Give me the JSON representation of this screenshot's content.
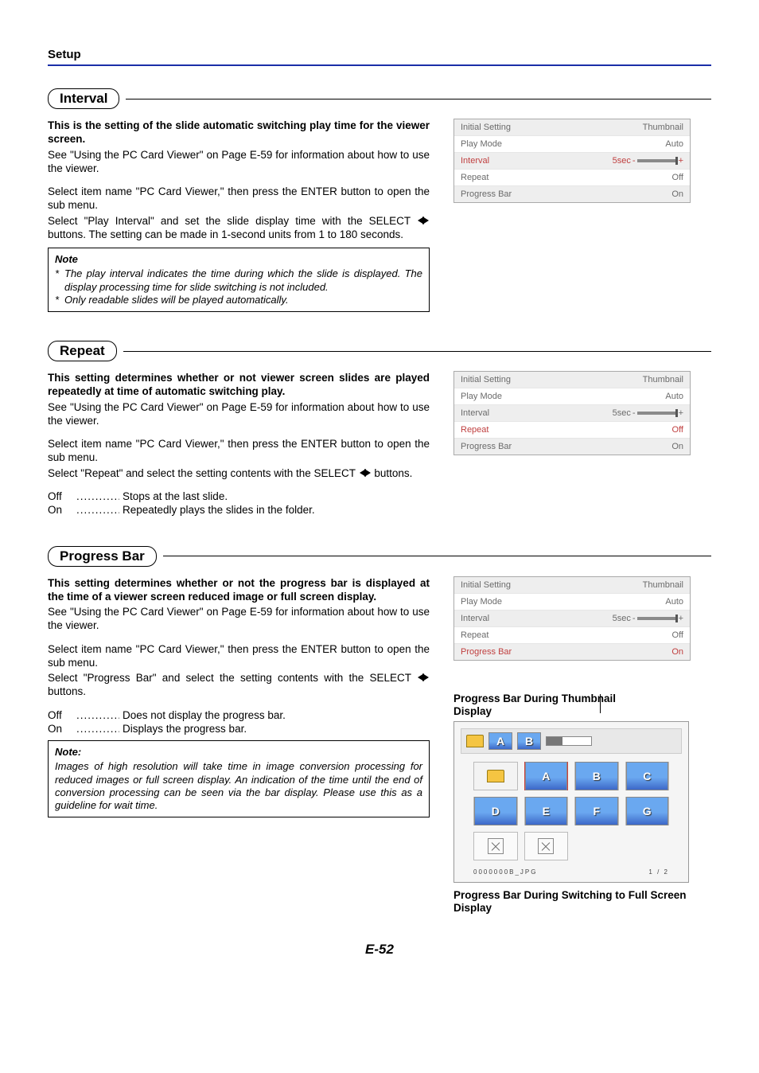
{
  "header": "Setup",
  "section_interval": {
    "title": "Interval",
    "lead": "This is the setting of the slide automatic switching play time for the viewer screen.",
    "p1": "See \"Using the PC Card Viewer\" on Page E-59 for information about how to use the viewer.",
    "p2": "Select item name \"PC Card Viewer,\" then press the ENTER button to open the sub menu.",
    "p3a": "Select \"Play Interval\" and set the slide display time with the SELECT ",
    "p3b": " buttons. The setting can be made in 1-second units from 1 to 180 seconds.",
    "note_title": "Note",
    "note1": "The play interval indicates the time during which the slide is displayed. The display processing time for slide switching is not included.",
    "note2": "Only readable slides will be played automatically."
  },
  "section_repeat": {
    "title": "Repeat",
    "lead": "This setting determines whether or not viewer screen slides are played repeatedly at time of automatic switching play.",
    "p1": "See \"Using the PC Card Viewer\" on Page E-59 for information about how to use the viewer.",
    "p2": "Select item name \"PC Card Viewer,\" then press the ENTER button to open the sub menu.",
    "p3a": "Select \"Repeat\" and select the setting contents with the SELECT ",
    "p3b": " buttons.",
    "off_label": "Off",
    "off_desc": "Stops at the last slide.",
    "on_label": "On",
    "on_desc": "Repeatedly plays the slides in the folder."
  },
  "section_progress": {
    "title": "Progress Bar",
    "lead": "This setting determines whether or not the progress bar is displayed at the time of a viewer screen reduced image or full screen display.",
    "p1": "See \"Using the PC Card Viewer\" on Page E-59 for information about how to use the viewer.",
    "p2": "Select item name \"PC Card Viewer,\" then press the ENTER button to open the sub menu.",
    "p3a": "Select \"Progress Bar\" and select the setting contents with the SELECT ",
    "p3b": " buttons.",
    "off_label": "Off",
    "off_desc": "Does not display the progress bar.",
    "on_label": "On",
    "on_desc": "Displays the progress bar.",
    "note_title": "Note:",
    "note1": "Images of high resolution will take time in image conversion processing for reduced images or full screen display. An indication of the time until the end of conversion processing can be seen via the bar display. Please use this as a guideline for wait time."
  },
  "menu": {
    "rows": [
      {
        "label": "Initial Setting",
        "value": "Thumbnail"
      },
      {
        "label": "Play Mode",
        "value": "Auto"
      },
      {
        "label": "Interval",
        "value_prefix": "5sec"
      },
      {
        "label": "Repeat",
        "value": "Off"
      },
      {
        "label": "Progress Bar",
        "value": "On"
      }
    ]
  },
  "captions": {
    "thumb": "Progress Bar During Thumbnail Display",
    "full": "Progress Bar During Switching to Full Screen Display"
  },
  "thumbnail_preview": {
    "bar_slides": [
      "A",
      "B"
    ],
    "grid_slides": [
      "A",
      "B",
      "C",
      "D",
      "E",
      "F",
      "G"
    ],
    "filename": "0000000B_JPG",
    "page": "1 / 2"
  },
  "dots": ".............",
  "page_number": "E-52"
}
